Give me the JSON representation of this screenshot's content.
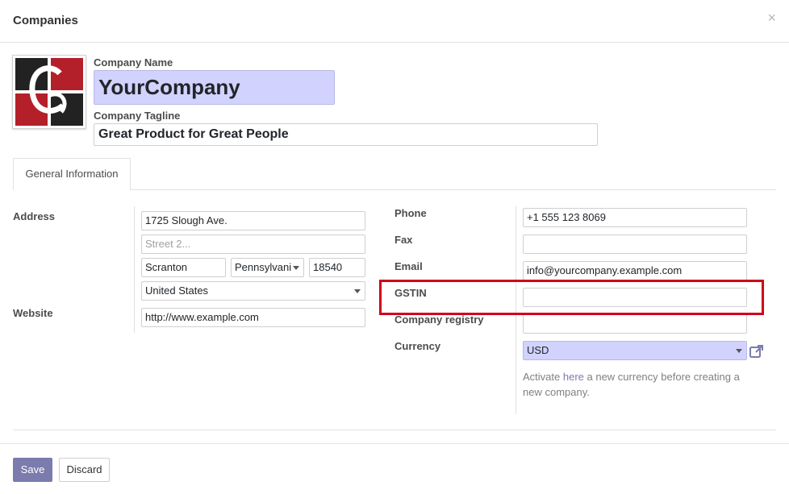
{
  "dialog": {
    "title": "Companies",
    "close_symbol": "×"
  },
  "header": {
    "company_name_label": "Company Name",
    "company_name_value": "YourCompany",
    "tagline_label": "Company Tagline",
    "tagline_value": "Great Product for Great People"
  },
  "tabs": [
    {
      "label": "General Information"
    }
  ],
  "address": {
    "label": "Address",
    "street": "1725 Slough Ave.",
    "street2_placeholder": "Street 2...",
    "city": "Scranton",
    "state": "Pennsylvani",
    "zip": "18540",
    "country": "United States",
    "website_label": "Website",
    "website": "http://www.example.com"
  },
  "contact": {
    "phone_label": "Phone",
    "phone": "+1 555 123 8069",
    "fax_label": "Fax",
    "fax": "",
    "email_label": "Email",
    "email": "info@yourcompany.example.com",
    "gstin_label": "GSTIN",
    "gstin": "",
    "registry_label": "Company registry",
    "registry": "",
    "currency_label": "Currency",
    "currency": "USD",
    "help_prefix": "Activate ",
    "help_link": "here",
    "help_suffix": " a new currency before creating a new company."
  },
  "footer": {
    "save_label": "Save",
    "discard_label": "Discard"
  },
  "colors": {
    "primary": "#7c7bad",
    "highlight_field": "#d2d2ff",
    "annotation": "#d0021b"
  },
  "icons": {
    "close": "close-icon",
    "logo": "company-logo",
    "external": "external-link-icon",
    "dropdown": "chevron-down-icon"
  }
}
